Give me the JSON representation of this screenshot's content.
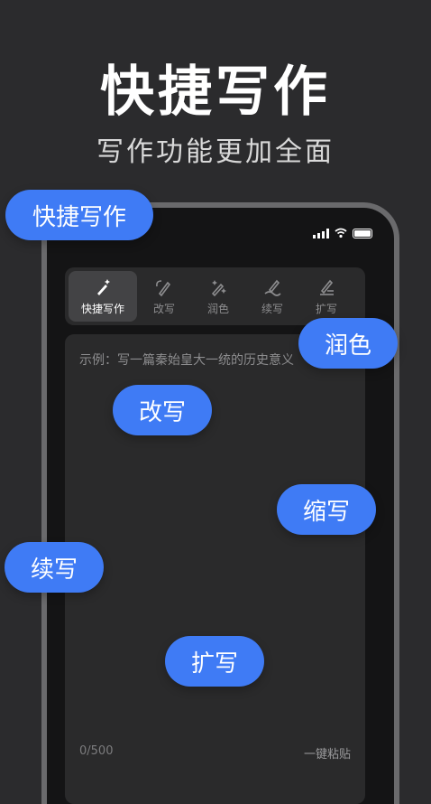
{
  "hero": {
    "title": "快捷写作",
    "subtitle": "写作功能更加全面"
  },
  "toolbar": {
    "items": [
      {
        "label": "快捷写作",
        "icon": "magic-pen-icon",
        "active": true
      },
      {
        "label": "改写",
        "icon": "rewrite-pen-icon",
        "active": false
      },
      {
        "label": "润色",
        "icon": "sparkle-pen-icon",
        "active": false
      },
      {
        "label": "续写",
        "icon": "continue-pen-icon",
        "active": false
      },
      {
        "label": "扩写",
        "icon": "expand-pen-icon",
        "active": false
      }
    ]
  },
  "editor": {
    "placeholder": "示例：写一篇秦始皇大一统的历史意义",
    "counter": "0/500",
    "paste_label": "一键粘贴"
  },
  "bubbles": {
    "quick_write": "快捷写作",
    "polish": "润色",
    "rewrite": "改写",
    "shorten": "缩写",
    "continue": "续写",
    "expand": "扩写"
  },
  "colors": {
    "background": "#2b2b2d",
    "accent": "#3f7bf5",
    "phone_frame": "#6a6a6c",
    "panel": "#2a2a2b"
  }
}
